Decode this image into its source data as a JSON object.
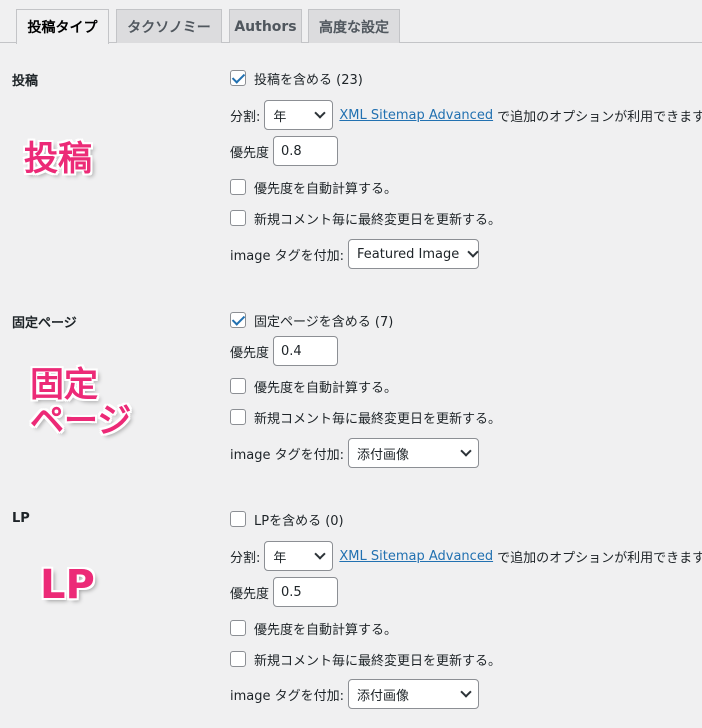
{
  "tabs": [
    {
      "label": "投稿タイプ",
      "active": true
    },
    {
      "label": "タクソノミー",
      "active": false
    },
    {
      "label": "Authors",
      "active": false
    },
    {
      "label": "高度な設定",
      "active": false
    }
  ],
  "posts": {
    "label": "投稿",
    "include_label": "投稿を含める (23)",
    "include_checked": true,
    "split_label": "分割:",
    "split_value": "年",
    "link_text": "XML Sitemap Advanced",
    "link_note": "で追加のオプションが利用できます。",
    "priority_label": "優先度",
    "priority_value": "0.8",
    "auto_priority_label": "優先度を自動計算する。",
    "update_lastmod_label": "新規コメント毎に最終変更日を更新する。",
    "image_tag_label": "image タグを付加:",
    "image_tag_value": "Featured Image",
    "annotation": "投稿"
  },
  "pages": {
    "label": "固定ページ",
    "include_label": "固定ページを含める (7)",
    "include_checked": true,
    "priority_label": "優先度",
    "priority_value": "0.4",
    "auto_priority_label": "優先度を自動計算する。",
    "update_lastmod_label": "新規コメント毎に最終変更日を更新する。",
    "image_tag_label": "image タグを付加:",
    "image_tag_value": "添付画像",
    "annotation_line1": "固定",
    "annotation_line2": "ページ"
  },
  "lp": {
    "label": "LP",
    "include_label": "LPを含める (0)",
    "include_checked": false,
    "split_label": "分割:",
    "split_value": "年",
    "link_text": "XML Sitemap Advanced",
    "link_note": "で追加のオプションが利用できます。",
    "priority_label": "優先度",
    "priority_value": "0.5",
    "auto_priority_label": "優先度を自動計算する。",
    "update_lastmod_label": "新規コメント毎に最終変更日を更新する。",
    "image_tag_label": "image タグを付加:",
    "image_tag_value": "添付画像",
    "annotation": "LP"
  },
  "colors": {
    "annotation": "#ec2a77",
    "link": "#2271b1",
    "background": "#f0f0f1"
  }
}
